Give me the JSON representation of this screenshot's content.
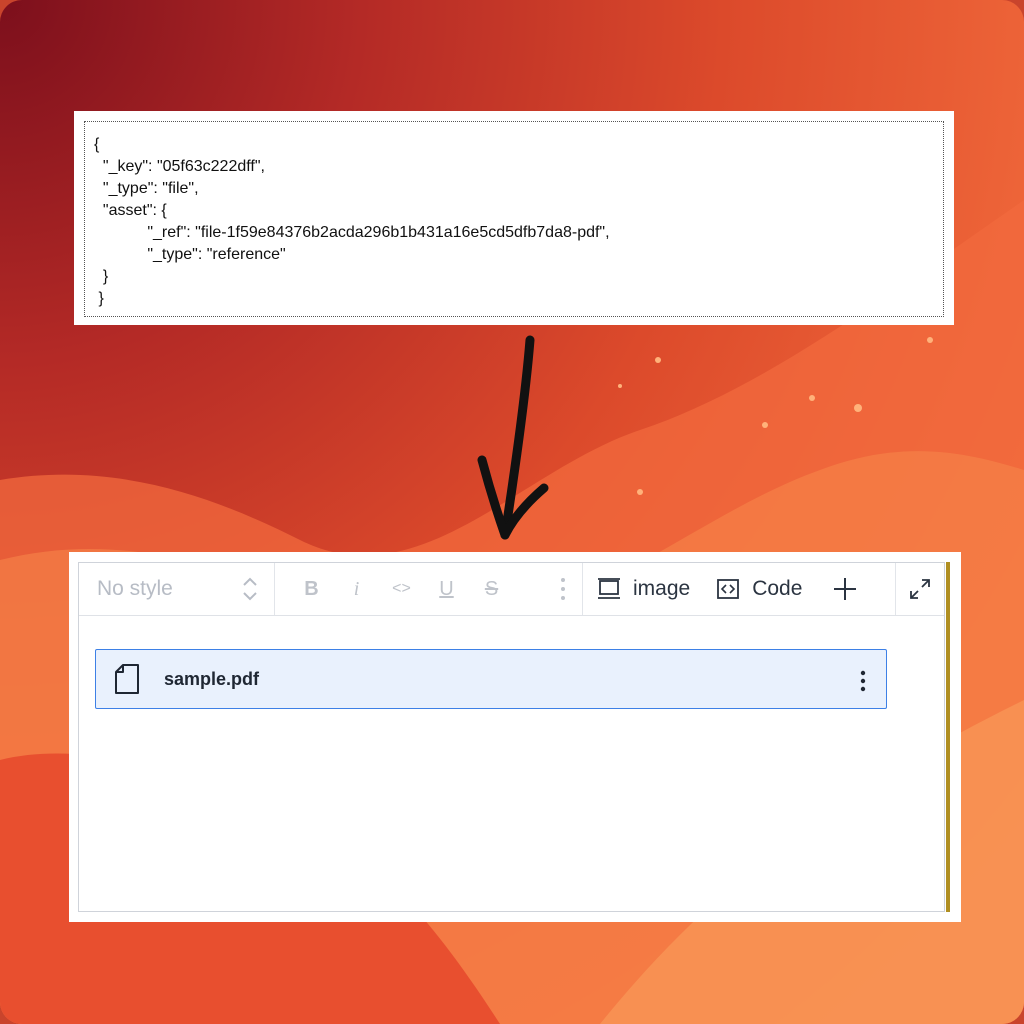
{
  "json_snippet": {
    "lines": [
      "{",
      "  \"_key\": \"05f63c222dff\",",
      "  \"_type\": \"file\",",
      "  \"asset\": {",
      "            \"_ref\": \"file-1f59e84376b2acda296b1b431a16e5cd5dfb7da8-pdf\",",
      "            \"_type\": \"reference\"",
      "  }",
      " }"
    ]
  },
  "editor": {
    "style_select": {
      "value": "No style",
      "icon": "chevron-up-down-icon"
    },
    "format_buttons": [
      {
        "label": "B",
        "name": "bold-button"
      },
      {
        "label": "i",
        "name": "italic-button"
      },
      {
        "label": "<>",
        "name": "inline-code-button"
      },
      {
        "label": "U",
        "name": "underline-button"
      },
      {
        "label": "S",
        "name": "strikethrough-button"
      }
    ],
    "insert_buttons": [
      {
        "label": "image",
        "icon": "image-block-icon"
      },
      {
        "label": "Code",
        "icon": "code-block-icon"
      }
    ],
    "file_block": {
      "filename": "sample.pdf",
      "icon": "document-icon"
    }
  },
  "colors": {
    "accent_border": "#3d80e6",
    "file_block_bg": "#e9f1fd",
    "scroll_accent": "#b08f22"
  }
}
